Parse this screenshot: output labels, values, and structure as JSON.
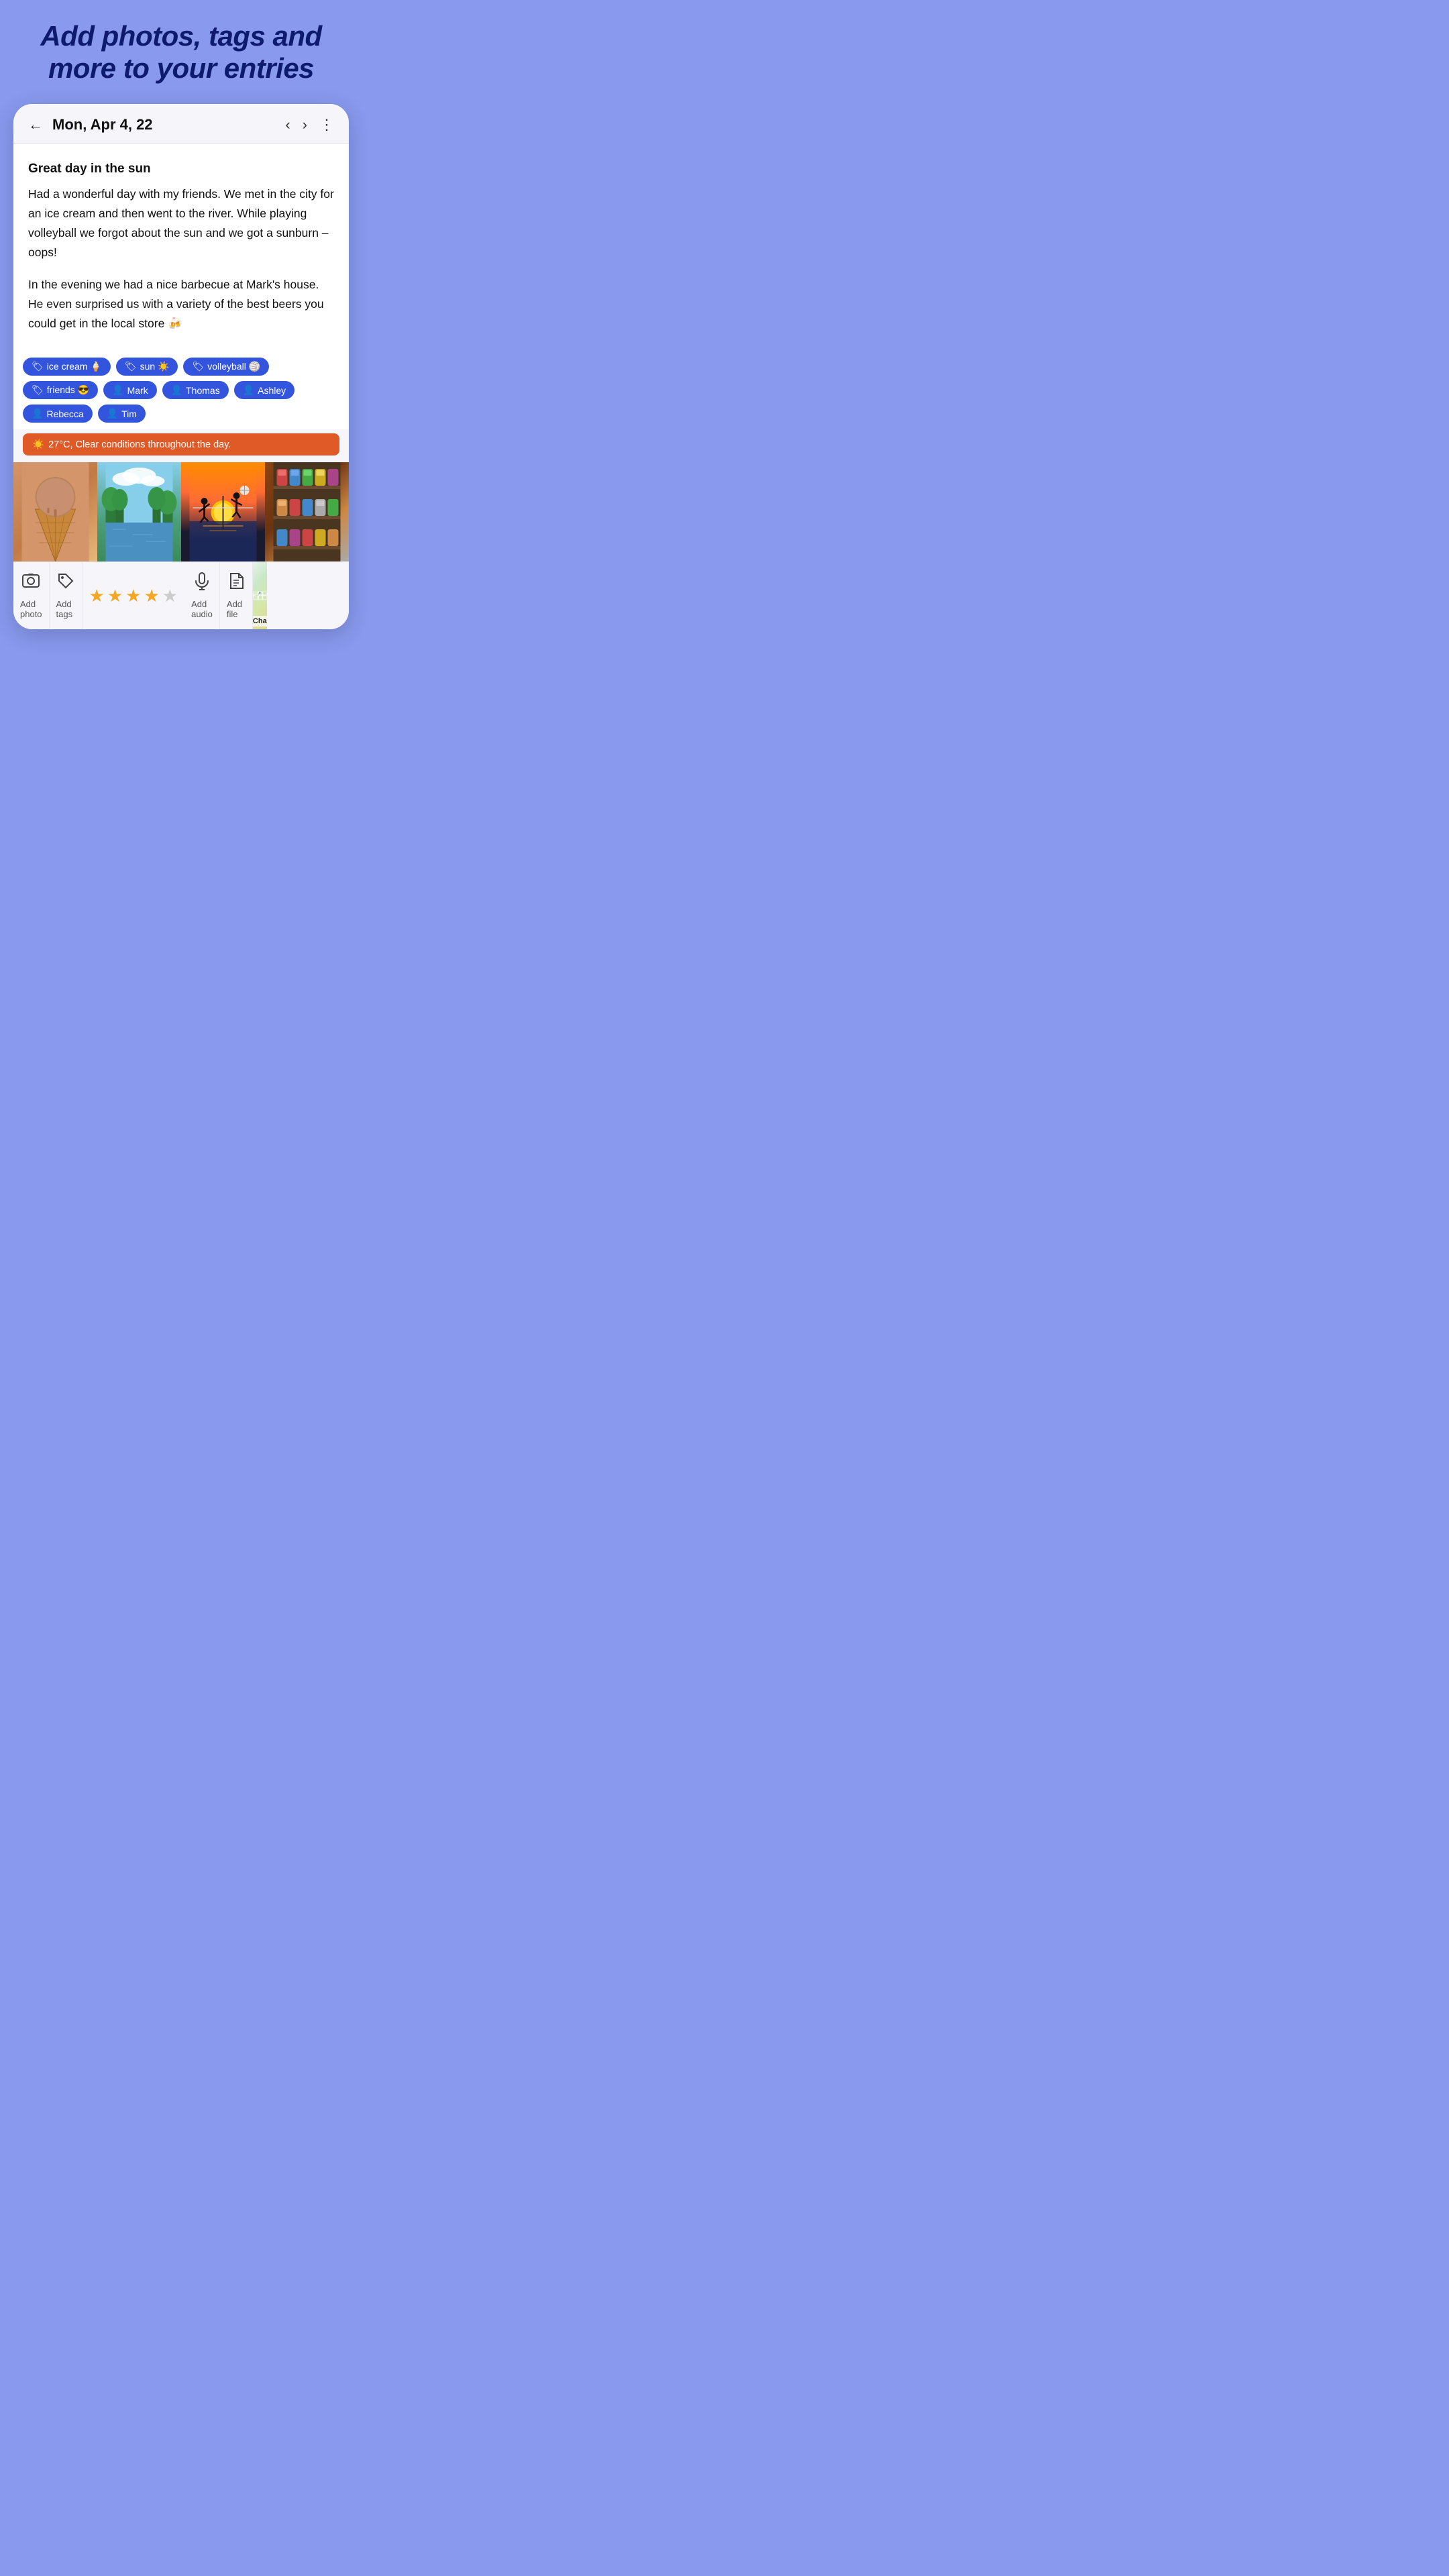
{
  "headline": {
    "line1": "Add photos, tags and",
    "line2": "more to your entries"
  },
  "header": {
    "date": "Mon, Apr 4, 22",
    "back_icon": "←",
    "prev_icon": "‹",
    "next_icon": "›",
    "more_icon": "⋮"
  },
  "entry": {
    "title": "Great day in the sun",
    "paragraph1": "Had a wonderful day with my friends. We met in the city for an ice cream and then went to the river. While playing volleyball we forgot about the sun and we got a sunburn – oops!",
    "paragraph2": "In the evening we had a nice barbecue at Mark's house. He even surprised us with a variety of the best beers you could get in the local store 🍻"
  },
  "tags": [
    {
      "id": "tag-ice-cream",
      "icon": "🏷",
      "label": "ice cream 🍦"
    },
    {
      "id": "tag-sun",
      "icon": "🏷",
      "label": "sun ☀️"
    },
    {
      "id": "tag-volleyball",
      "icon": "🏷",
      "label": "volleyball 🏐"
    },
    {
      "id": "tag-friends",
      "icon": "🏷",
      "label": "friends 😎"
    },
    {
      "id": "tag-mark",
      "icon": "👤",
      "label": "Mark"
    },
    {
      "id": "tag-thomas",
      "icon": "👤",
      "label": "Thomas"
    },
    {
      "id": "tag-ashley",
      "icon": "👤",
      "label": "Ashley"
    },
    {
      "id": "tag-rebecca",
      "icon": "👤",
      "label": "Rebecca"
    },
    {
      "id": "tag-tim",
      "icon": "👤",
      "label": "Tim"
    }
  ],
  "weather": {
    "icon": "☀️",
    "text": "27°C, Clear conditions throughout the day."
  },
  "photos": [
    {
      "id": "photo-ice-cream",
      "emoji": "🍦",
      "alt": "Ice cream cone"
    },
    {
      "id": "photo-river",
      "emoji": "🏞",
      "alt": "River view"
    },
    {
      "id": "photo-volleyball",
      "emoji": "🏐",
      "alt": "Volleyball at sunset"
    },
    {
      "id": "photo-beers",
      "emoji": "🍺",
      "alt": "Beer shelf"
    }
  ],
  "actions": {
    "add_photo_label": "Add photo",
    "add_tags_label": "Add tags",
    "add_audio_label": "Add audio",
    "add_file_label": "Add file"
  },
  "stars": {
    "filled": 4,
    "total": 5
  },
  "map": {
    "label": "Chandler"
  }
}
